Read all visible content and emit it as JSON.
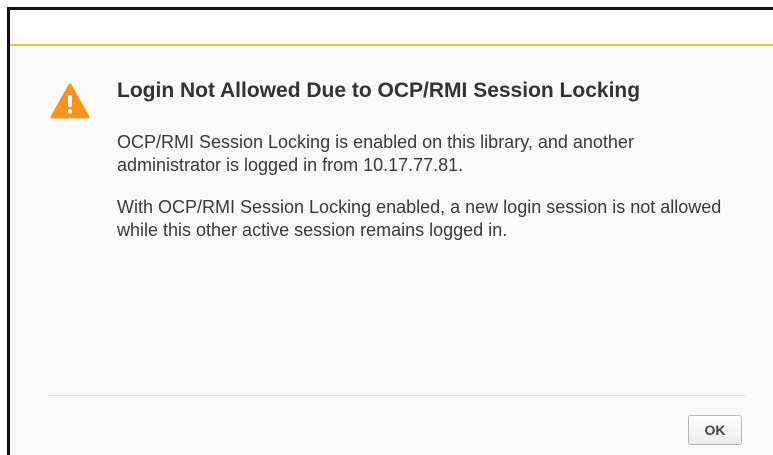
{
  "dialog": {
    "title": "Login Not Allowed Due to OCP/RMI Session Locking",
    "icon": "warning-icon",
    "accent_color": "#f1c232",
    "icon_color": "#f7941d",
    "paragraphs": [
      "OCP/RMI Session Locking is enabled on this library, and another administrator is logged in from 10.17.77.81.",
      "With OCP/RMI Session Locking enabled, a new login session is not allowed while this other active session remains logged in."
    ],
    "ok_label": "OK"
  }
}
